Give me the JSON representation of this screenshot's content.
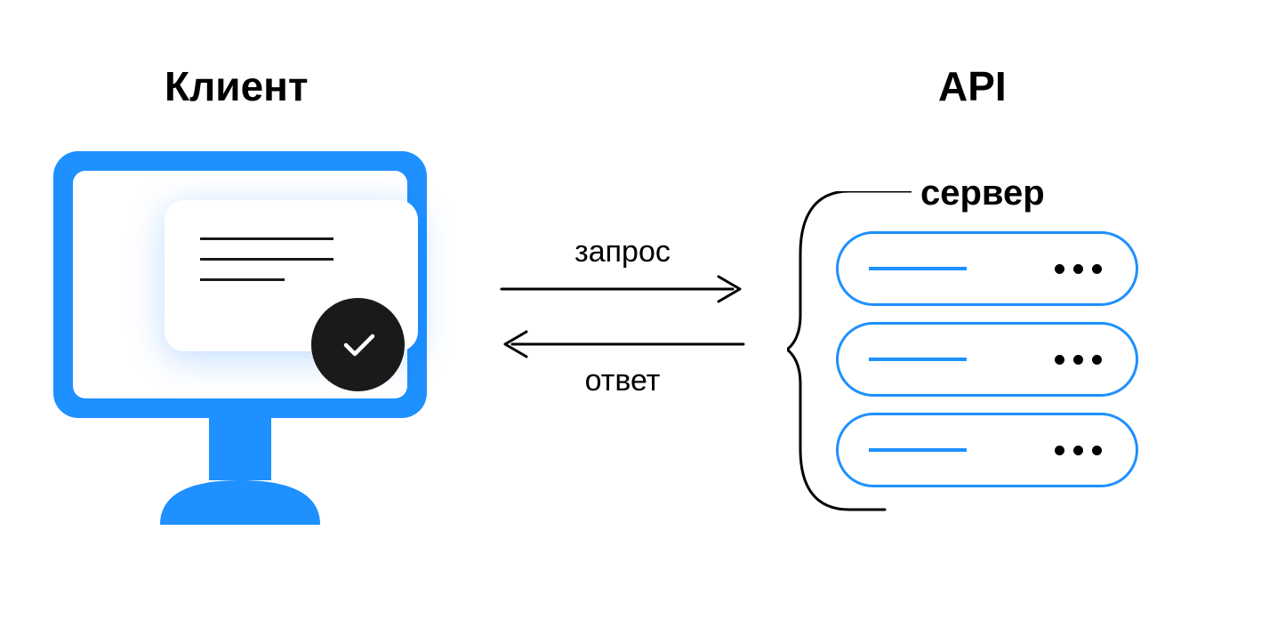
{
  "labels": {
    "client_title": "Клиент",
    "api_title": "API",
    "request": "запрос",
    "response": "ответ",
    "server": "сервер"
  },
  "colors": {
    "accent": "#1e90ff",
    "dark": "#1a1a1a"
  },
  "server": {
    "node_count": 3
  }
}
